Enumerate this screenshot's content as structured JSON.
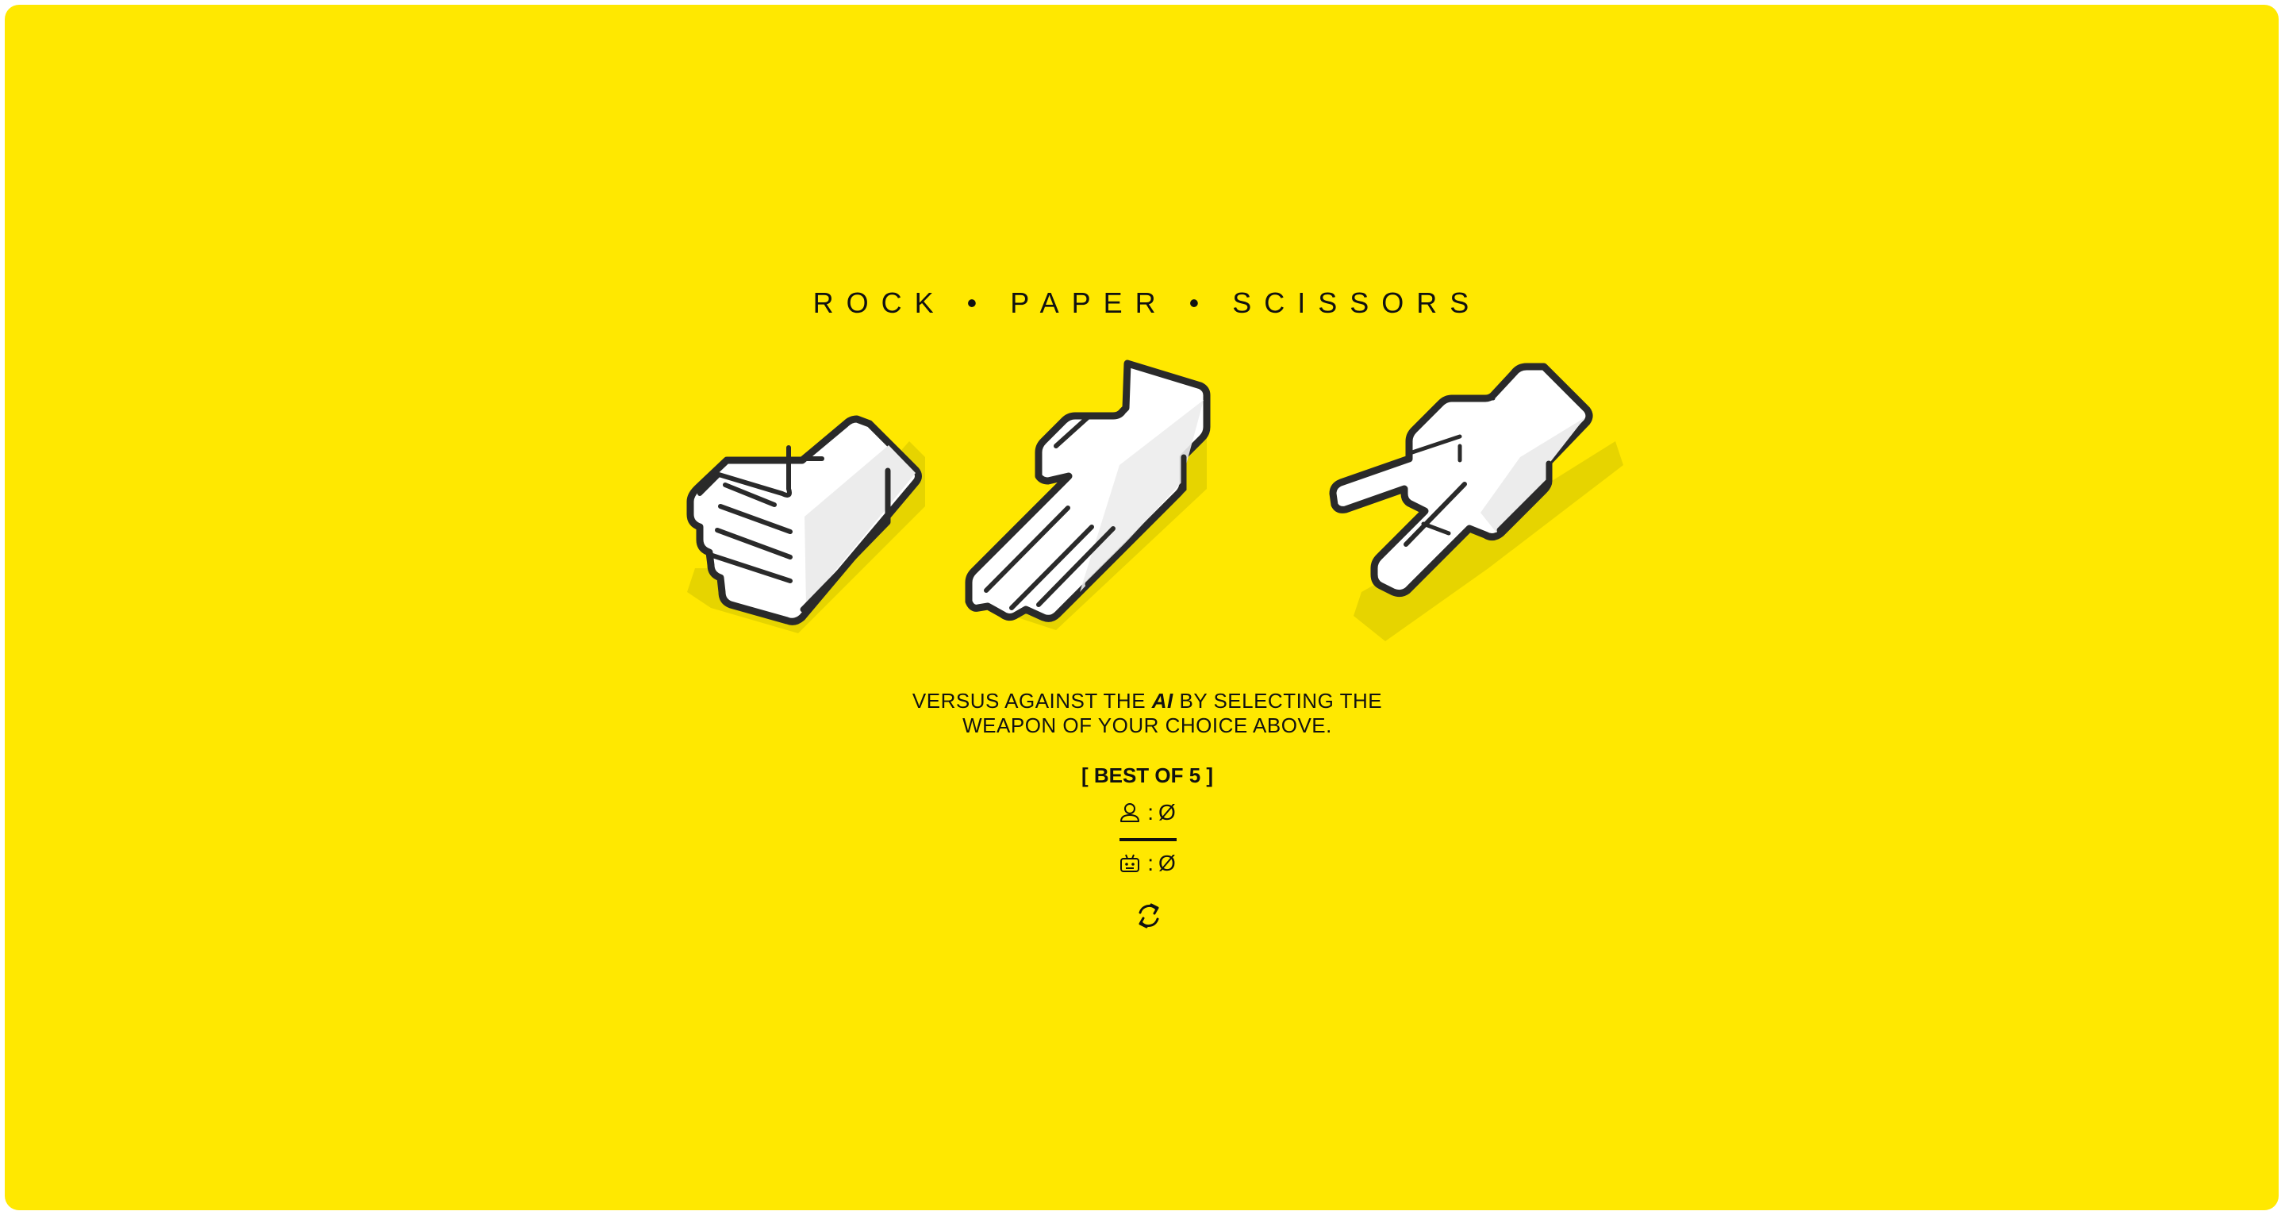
{
  "title": "ROCK • PAPER • SCISSORS",
  "weapons": [
    {
      "name": "rock"
    },
    {
      "name": "paper"
    },
    {
      "name": "scissors"
    }
  ],
  "instructions": {
    "before_ai": "VERSUS AGAINST THE ",
    "ai": "AI",
    "after_ai": " BY SELECTING THE",
    "line2": "WEAPON OF YOUR CHOICE ABOVE."
  },
  "best_of": "[ BEST OF 5 ]",
  "score": {
    "player_icon": "user-icon",
    "ai_icon": "robot-icon",
    "separator": ":",
    "player": "Ø",
    "ai": "Ø"
  },
  "reset_icon": "refresh-icon",
  "colors": {
    "background": "#FFE800",
    "outline": "#2a2a2a",
    "hand_fill": "#ffffff",
    "hand_shade": "#ececec",
    "shadow": "#e8d600"
  }
}
